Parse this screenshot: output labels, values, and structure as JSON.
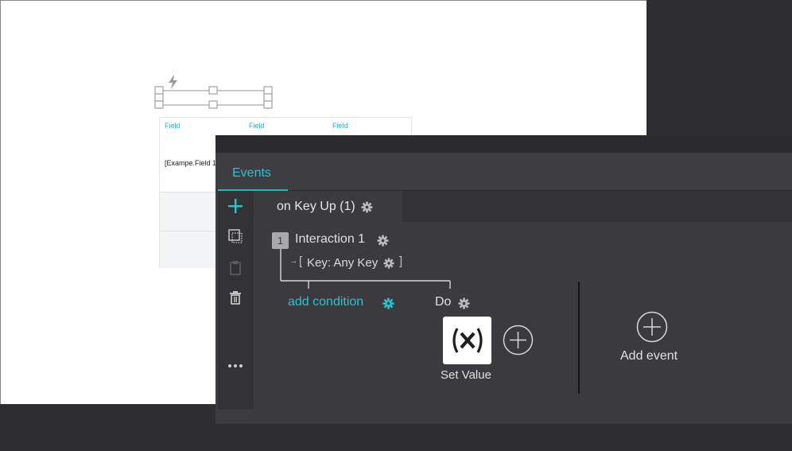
{
  "canvas": {
    "table_headers": [
      "Field",
      "Field",
      "Field"
    ],
    "table_cell": "[Exampe.Field 1"
  },
  "panel": {
    "tab_label": "Events"
  },
  "toolbar": {
    "items": [
      {
        "icon": "plus-icon",
        "enabled": true
      },
      {
        "icon": "select-region-icon",
        "enabled": true
      },
      {
        "icon": "clipboard-icon",
        "enabled": false
      },
      {
        "icon": "trash-icon",
        "enabled": true
      },
      {
        "icon": "more-icon",
        "enabled": true
      }
    ]
  },
  "event": {
    "tab_label": "on Key Up (1)",
    "interaction_number": "1",
    "interaction_name": "Interaction 1",
    "trigger_label": "Key: Any Key",
    "add_condition": "add condition",
    "do_label": "Do",
    "action_label": "Set Value",
    "add_event_label": "Add event"
  },
  "colors": {
    "accent": "#2ac3d0",
    "panel_bg": "#3c3c40",
    "toolbar_bg": "#333336"
  }
}
